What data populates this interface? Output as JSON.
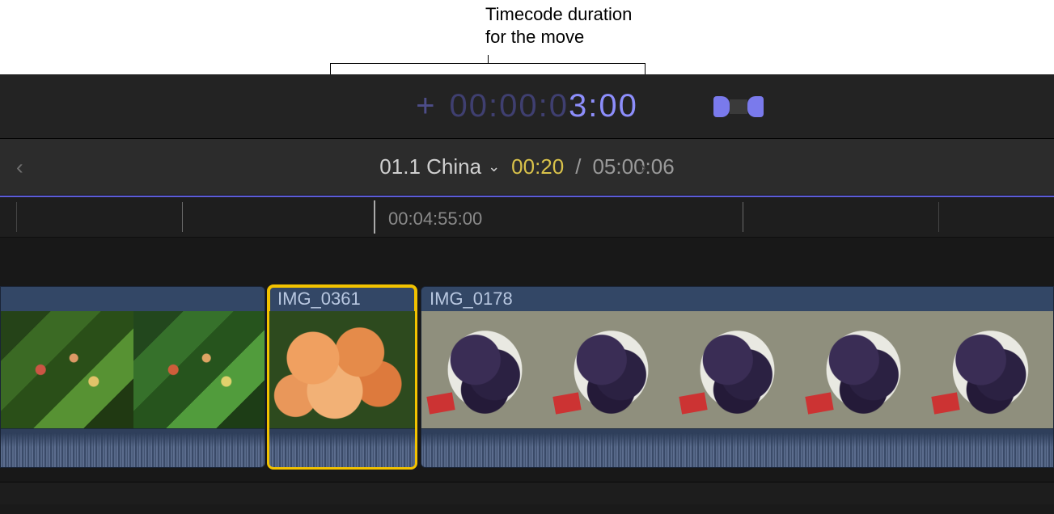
{
  "callout": {
    "line1": "Timecode duration",
    "line2": "for the move"
  },
  "timecode_input": {
    "sign": "+",
    "dim_prefix": "00:00:0",
    "bright_part": "3:00"
  },
  "project": {
    "name": "01.1 China",
    "current_duration": "00:20",
    "separator": "/",
    "total_duration": "05:00:06"
  },
  "ruler": {
    "playhead_label": "00:04:55:00"
  },
  "clips": [
    {
      "label": "",
      "selected": false
    },
    {
      "label": "IMG_0361",
      "selected": true
    },
    {
      "label": "IMG_0178",
      "selected": false
    }
  ],
  "icons": {
    "prev": "‹",
    "next": "›",
    "dropdown": "⌄"
  }
}
